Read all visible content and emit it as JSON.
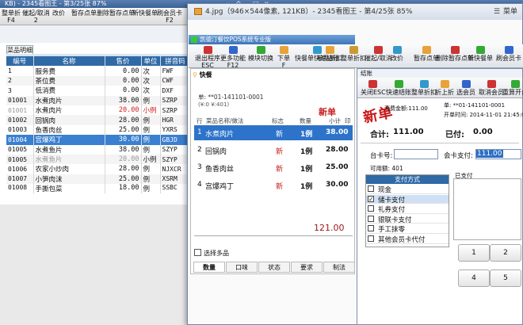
{
  "back_viewer": {
    "title": "KB) - 2345看图王 - 第3/25张 87%",
    "mini_buttons": [
      "─",
      "全屏",
      "□",
      "×"
    ]
  },
  "back_pos": {
    "toolbar": [
      {
        "label": "整单折",
        "sub": "F4"
      },
      {
        "label": "催起/取消",
        "sub": "2"
      },
      {
        "label": "改价",
        "sub": ""
      },
      {
        "label": "暂存点单",
        "sub": ""
      },
      {
        "label": "删除暂存点单",
        "sub": ""
      },
      {
        "label": "新快餐单",
        "sub": ""
      },
      {
        "label": "刷会员卡",
        "sub": "F2"
      }
    ],
    "panel_title": "菜品明细",
    "columns": [
      "编号",
      "名称",
      "售价",
      "单位",
      "拼音码"
    ],
    "rows": [
      {
        "code": "1",
        "name": "服务费",
        "price": "0.00",
        "unit": "次",
        "py": "FWF",
        "style": ""
      },
      {
        "code": "2",
        "name": "茶位费",
        "price": "0.00",
        "unit": "次",
        "py": "CWF",
        "style": ""
      },
      {
        "code": "3",
        "name": "低消费",
        "price": "0.00",
        "unit": "次",
        "py": "DXF",
        "style": ""
      },
      {
        "code": "01001",
        "name": "水煮肉片",
        "price": "38.00",
        "unit": "例",
        "py": "SZRP",
        "style": ""
      },
      {
        "code": "01001",
        "name": "水煮肉片",
        "price": "20.00",
        "unit": "小例",
        "py": "SZRP",
        "style": "red"
      },
      {
        "code": "01002",
        "name": "回锅肉",
        "price": "28.00",
        "unit": "例",
        "py": "HGR",
        "style": ""
      },
      {
        "code": "01003",
        "name": "鱼香肉丝",
        "price": "25.00",
        "unit": "例",
        "py": "YXRS",
        "style": ""
      },
      {
        "code": "01004",
        "name": "宫爆鸡丁",
        "price": "30.00",
        "unit": "例",
        "py": "GBJD",
        "style": "sel"
      },
      {
        "code": "01005",
        "name": "水煮鱼片",
        "price": "38.00",
        "unit": "例",
        "py": "SZYP",
        "style": ""
      },
      {
        "code": "01005",
        "name": "水煮鱼片",
        "price": "20.00",
        "unit": "小例",
        "py": "SZYP",
        "style": "grey"
      },
      {
        "code": "01006",
        "name": "农家小炒肉",
        "price": "28.00",
        "unit": "例",
        "py": "NJXCR",
        "style": ""
      },
      {
        "code": "01007",
        "name": "小笋肉沫",
        "price": "25.00",
        "unit": "例",
        "py": "XSRM",
        "style": ""
      },
      {
        "code": "01008",
        "name": "手撕包菜",
        "price": "18.00",
        "unit": "例",
        "py": "SSBC",
        "style": "cut"
      }
    ]
  },
  "front_viewer": {
    "title": "4.jpg（946×544像素, 121KB）- 2345看图王 - 第4/25张 85%",
    "menu": "菜单",
    "mini_buttons": [
      "─",
      "全屏",
      "□",
      "×"
    ]
  },
  "pos": {
    "window_title": "凯德汀餐饮POS系统专业版",
    "toolbar": [
      {
        "label": "退出程序",
        "sub": "ESC"
      },
      {
        "label": "更多功能",
        "sub": "F12"
      },
      {
        "label": "模块切换",
        "sub": ""
      },
      {
        "label": "下单",
        "sub": "F"
      },
      {
        "label": "快餐单快速结账",
        "sub": ""
      },
      {
        "label": "单品折扣",
        "sub": ""
      },
      {
        "label": "整单折扣",
        "sub": ""
      },
      {
        "label": "催起/取消",
        "sub": ""
      },
      {
        "label": "改价",
        "sub": ""
      },
      {
        "label": "暂存点单",
        "sub": ""
      },
      {
        "label": "删除暂存点单",
        "sub": ""
      },
      {
        "label": "新快餐单",
        "sub": ""
      },
      {
        "label": "刷会员卡",
        "sub": ""
      }
    ],
    "tab": "快餐",
    "order_no": "单: **01-141101-0001",
    "order_sub": "(¥:0 ¥:401)",
    "new_stamp": "新单",
    "order_columns": [
      "行",
      "菜品名称/做法",
      "标志",
      "数量",
      "小计",
      "印"
    ],
    "order_items": [
      {
        "row": "1",
        "name": "水煮肉片",
        "flag": "新",
        "qty": "1例",
        "total": "38.00",
        "sel": true
      },
      {
        "row": "2",
        "name": "回锅肉",
        "flag": "新",
        "qty": "1例",
        "total": "28.00",
        "sel": false
      },
      {
        "row": "3",
        "name": "鱼香肉丝",
        "flag": "新",
        "qty": "1例",
        "total": "25.00",
        "sel": false
      },
      {
        "row": "4",
        "name": "宫爆鸡丁",
        "flag": "新",
        "qty": "1例",
        "total": "30.00",
        "sel": false
      }
    ],
    "total": "121.00",
    "multi_select": "选择多品",
    "bottom_tabs": [
      "数量",
      "口味",
      "状态",
      "要求",
      "制法"
    ]
  },
  "checkout": {
    "title": "结账",
    "toolbar": [
      "关闭ESC",
      "快速结账",
      "整单折扣",
      "折上折",
      "选会员",
      "取消会员",
      "重算开台"
    ],
    "stamp": "新单",
    "total_label": "消费金额:",
    "total_value": "111.00",
    "order_no": "单: **01-141101-0001",
    "open_time": "开单时间: 2014-11-01 21:45:02",
    "sum_label": "合计:",
    "sum_value": "111.00",
    "paid_label": "已付:",
    "paid_value": "0.00",
    "table_card_label": "台卡号:",
    "member_card_label": "会卡支付:",
    "member_card_value": "111.00",
    "points_label": "可用额: 401",
    "paid_header": "已支付",
    "pay_header": "支付方式",
    "pay_methods": [
      {
        "label": "现金",
        "checked": false,
        "sel": false
      },
      {
        "label": "储卡支付",
        "checked": true,
        "sel": true
      },
      {
        "label": "礼券支付",
        "checked": false,
        "sel": false
      },
      {
        "label": "银联卡支付",
        "checked": false,
        "sel": false
      },
      {
        "label": "手工抹零",
        "checked": false,
        "sel": false
      },
      {
        "label": "其他会员卡代付",
        "checked": false,
        "sel": false
      }
    ],
    "keys": [
      "1",
      "2",
      "4",
      "5"
    ]
  },
  "colors": {
    "accent": "#2c73c9",
    "header": "#2f6aa6",
    "red": "#d01818"
  }
}
